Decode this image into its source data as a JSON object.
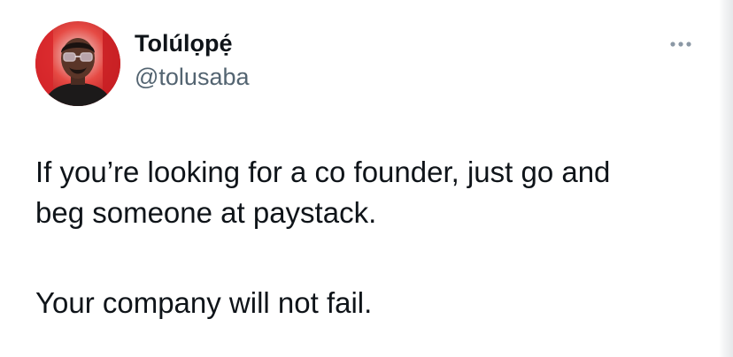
{
  "author": {
    "display_name": "Tolúlọpẹ́",
    "handle": "@tolusaba",
    "avatar_icon": "profile-photo"
  },
  "actions": {
    "more_icon": "more-horizontal-icon"
  },
  "tweet": {
    "paragraph_1_line_1": "If you’re looking for a co founder, just go and",
    "paragraph_1_line_2": "beg someone at paystack.",
    "paragraph_2": "Your company will not fail."
  },
  "colors": {
    "text_primary": "#0f1419",
    "text_secondary": "#536471",
    "avatar_background": "#d8262a",
    "more_dots": "#8b98a5"
  }
}
